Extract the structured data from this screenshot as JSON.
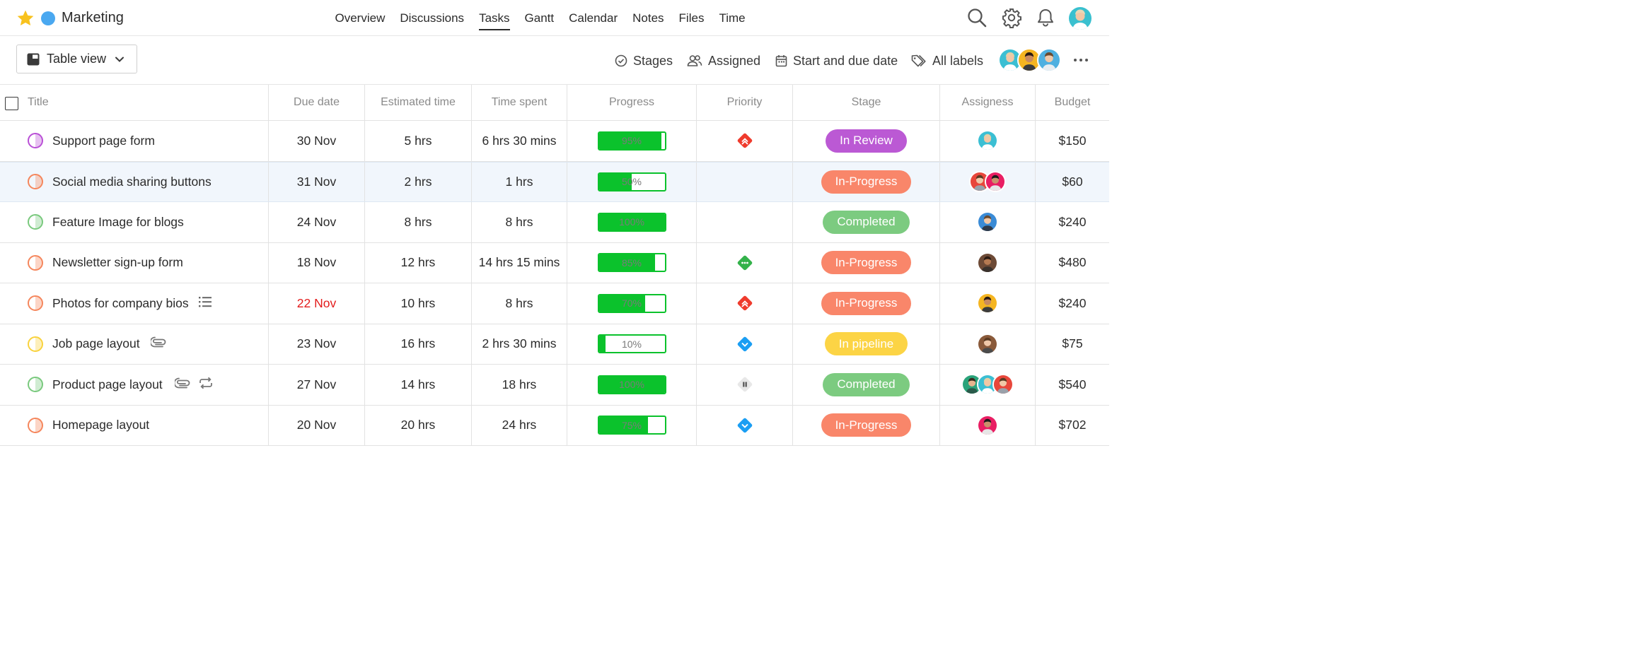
{
  "app": {
    "project_name": "Marketing",
    "project_color": "#4aa8f0",
    "favorite_color": "#f8c21e"
  },
  "nav": {
    "items": [
      "Overview",
      "Discussions",
      "Tasks",
      "Gantt",
      "Calendar",
      "Notes",
      "Files",
      "Time"
    ],
    "active": "Tasks"
  },
  "header_icons": [
    "search-icon",
    "gear-icon",
    "bell-icon",
    "user-avatar"
  ],
  "toolbar": {
    "view_label": "Table view",
    "filters": {
      "stages": "Stages",
      "assigned": "Assigned",
      "dates": "Start and due date",
      "labels": "All labels"
    }
  },
  "table": {
    "columns": {
      "title": "Title",
      "due": "Due date",
      "estimated": "Estimated time",
      "spent": "Time spent",
      "progress": "Progress",
      "priority": "Priority",
      "stage": "Stage",
      "assignees": "Assigness",
      "budget": "Budget"
    },
    "rows": [
      {
        "title": "Support page form",
        "status_color": "#b94fd6",
        "due": "30 Nov",
        "overdue": false,
        "estimated": "5 hrs",
        "spent": "6 hrs 30 mins",
        "progress": 95,
        "progress_label": "95%",
        "priority": "urgent",
        "stage": "In Review",
        "stage_color": "#bb59d4",
        "assignees": 1,
        "budget": "$150",
        "icons": []
      },
      {
        "title": "Social media sharing buttons",
        "status_color": "#f5865c",
        "due": "31 Nov",
        "overdue": false,
        "estimated": "2 hrs",
        "spent": "1 hrs",
        "progress": 50,
        "progress_label": "50%",
        "priority": "none",
        "stage": "In-Progress",
        "stage_color": "#f9866a",
        "assignees": 2,
        "budget": "$60",
        "icons": []
      },
      {
        "title": "Feature Image for blogs",
        "status_color": "#79c97d",
        "due": "24 Nov",
        "overdue": false,
        "estimated": "8 hrs",
        "spent": "8 hrs",
        "progress": 100,
        "progress_label": "100%",
        "priority": "none",
        "stage": "Completed",
        "stage_color": "#7ccb80",
        "assignees": 1,
        "budget": "$240",
        "icons": []
      },
      {
        "title": "Newsletter sign-up form",
        "status_color": "#f5865c",
        "due": "18 Nov",
        "overdue": false,
        "estimated": "12 hrs",
        "spent": "14 hrs 15 mins",
        "progress": 85,
        "progress_label": "85%",
        "priority": "medium",
        "stage": "In-Progress",
        "stage_color": "#f9866a",
        "assignees": 1,
        "budget": "$480",
        "icons": []
      },
      {
        "title": "Photos for company bios",
        "status_color": "#f5865c",
        "due": "22 Nov",
        "overdue": true,
        "estimated": "10 hrs",
        "spent": "8 hrs",
        "progress": 70,
        "progress_label": "70%",
        "priority": "urgent",
        "stage": "In-Progress",
        "stage_color": "#f9866a",
        "assignees": 1,
        "budget": "$240",
        "icons": [
          "checklist-icon"
        ]
      },
      {
        "title": "Job page layout",
        "status_color": "#f9d23c",
        "due": "23 Nov",
        "overdue": false,
        "estimated": "16 hrs",
        "spent": "2 hrs 30 mins",
        "progress": 10,
        "progress_label": "10%",
        "priority": "low",
        "stage": "In pipeline",
        "stage_color": "#fcd445",
        "assignees": 1,
        "budget": "$75",
        "icons": [
          "attachment-icon"
        ]
      },
      {
        "title": "Product page layout",
        "status_color": "#79c97d",
        "due": "27 Nov",
        "overdue": false,
        "estimated": "14 hrs",
        "spent": "18 hrs",
        "progress": 100,
        "progress_label": "100%",
        "priority": "paused",
        "stage": "Completed",
        "stage_color": "#7ccb80",
        "assignees": 3,
        "budget": "$540",
        "icons": [
          "attachment-icon",
          "recurring-icon"
        ]
      },
      {
        "title": "Homepage layout",
        "status_color": "#f5865c",
        "due": "20 Nov",
        "overdue": false,
        "estimated": "20 hrs",
        "spent": "24 hrs",
        "progress": 75,
        "progress_label": "75%",
        "priority": "low",
        "stage": "In-Progress",
        "stage_color": "#f9866a",
        "assignees": 1,
        "budget": "$702",
        "icons": []
      }
    ]
  }
}
